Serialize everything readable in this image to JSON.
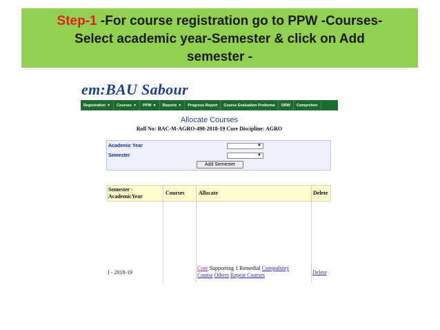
{
  "banner": {
    "step": "Step-1",
    "line1_rest": " -For course registration go to PPW -Courses-",
    "line2": "Select academic year-Semester & click on Add",
    "line3": "semester -"
  },
  "app": {
    "header_text": "em:BAU Sabour",
    "menu": [
      {
        "label": "Registration",
        "has_caret": true
      },
      {
        "label": "Courses",
        "has_caret": true
      },
      {
        "label": "PPW",
        "has_caret": true
      },
      {
        "label": "Reports",
        "has_caret": true
      },
      {
        "label": "Progress Report",
        "has_caret": false
      },
      {
        "label": "Course Evaluation Proforma",
        "has_caret": false
      },
      {
        "label": "ORW",
        "has_caret": false
      },
      {
        "label": "Comprehen",
        "has_caret": false
      }
    ],
    "page_title": "Allocate Courses",
    "roll_line": "Roll No: BAC-M-AGRO-498-2018-19 Core Discipline: AGRO",
    "form": {
      "academic_year_label": "Academic Year",
      "academic_year_value": "",
      "semester_label": "Semester",
      "semester_value": "",
      "add_button": "Add Semester"
    },
    "table": {
      "headers": {
        "semester": "Semester - AcademicYear",
        "courses": "Courses",
        "allocate": "Allocate",
        "delete": "Delete"
      },
      "row": {
        "semester": "I - 2018-19",
        "allocate_links": {
          "core": "Core",
          "supporting": " Supporting 1 Remedial ",
          "compulsory": "Compulsory",
          "course": "Course",
          "others": "Others",
          "repeat": "Repeat Courses"
        },
        "delete": "Delete"
      }
    }
  },
  "colors": {
    "banner_bg": "#92d050",
    "step_red": "#e0201b",
    "menu_green": "#1d6b2e",
    "header_blue": "#1f3f8f",
    "grid_head_bg": "#fffbcc"
  }
}
